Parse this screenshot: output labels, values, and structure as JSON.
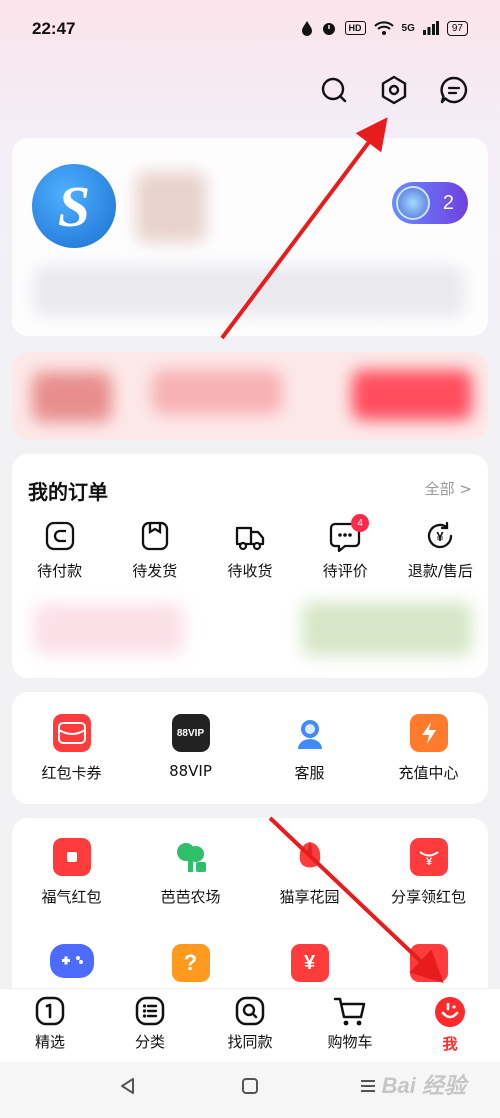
{
  "status": {
    "time": "22:47",
    "hd": "HD",
    "network": "5G",
    "battery": "97"
  },
  "vip_count": "2",
  "orders": {
    "title": "我的订单",
    "all": "全部 >",
    "items": [
      {
        "label": "待付款"
      },
      {
        "label": "待发货"
      },
      {
        "label": "待收货"
      },
      {
        "label": "待评价",
        "badge": "4"
      },
      {
        "label": "退款/售后"
      }
    ]
  },
  "services": [
    {
      "label": "红包卡券",
      "icon": "red-packet-coupon-icon",
      "color": "#ff3b3b"
    },
    {
      "label": "88VIP",
      "icon": "88vip-icon",
      "text": "88VIP",
      "color": "#222222"
    },
    {
      "label": "客服",
      "icon": "customer-service-icon",
      "color": "#3d8bff"
    },
    {
      "label": "充值中心",
      "icon": "recharge-lightning-icon",
      "color": "#ff7a2a"
    }
  ],
  "games": [
    {
      "label": "福气红包",
      "icon": "lucky-red-packet-icon",
      "color": "#ff3b3b"
    },
    {
      "label": "芭芭农场",
      "icon": "baba-farm-tree-icon",
      "color": "#2fbf6a"
    },
    {
      "label": "猫享花园",
      "icon": "garden-flower-icon",
      "color": "#ff3b3b"
    },
    {
      "label": "分享领红包",
      "icon": "share-red-packet-icon",
      "color": "#ff3b3b"
    }
  ],
  "games_row2": [
    {
      "icon": "game-controller-icon",
      "color": "#4d6cff"
    },
    {
      "icon": "question-house-icon",
      "color": "#ff9a1f",
      "text": "?"
    },
    {
      "icon": "yuan-red-icon",
      "color": "#ff3b3b",
      "text": "¥"
    },
    {
      "icon": "calendar-icon",
      "color": "#ff3b3b"
    }
  ],
  "tabs": [
    {
      "label": "精选",
      "icon": "home-select-icon"
    },
    {
      "label": "分类",
      "icon": "category-icon"
    },
    {
      "label": "找同款",
      "icon": "find-same-icon"
    },
    {
      "label": "购物车",
      "icon": "cart-icon"
    },
    {
      "label": "我",
      "icon": "me-face-icon",
      "active": true
    }
  ],
  "watermark": "Bai 经验"
}
